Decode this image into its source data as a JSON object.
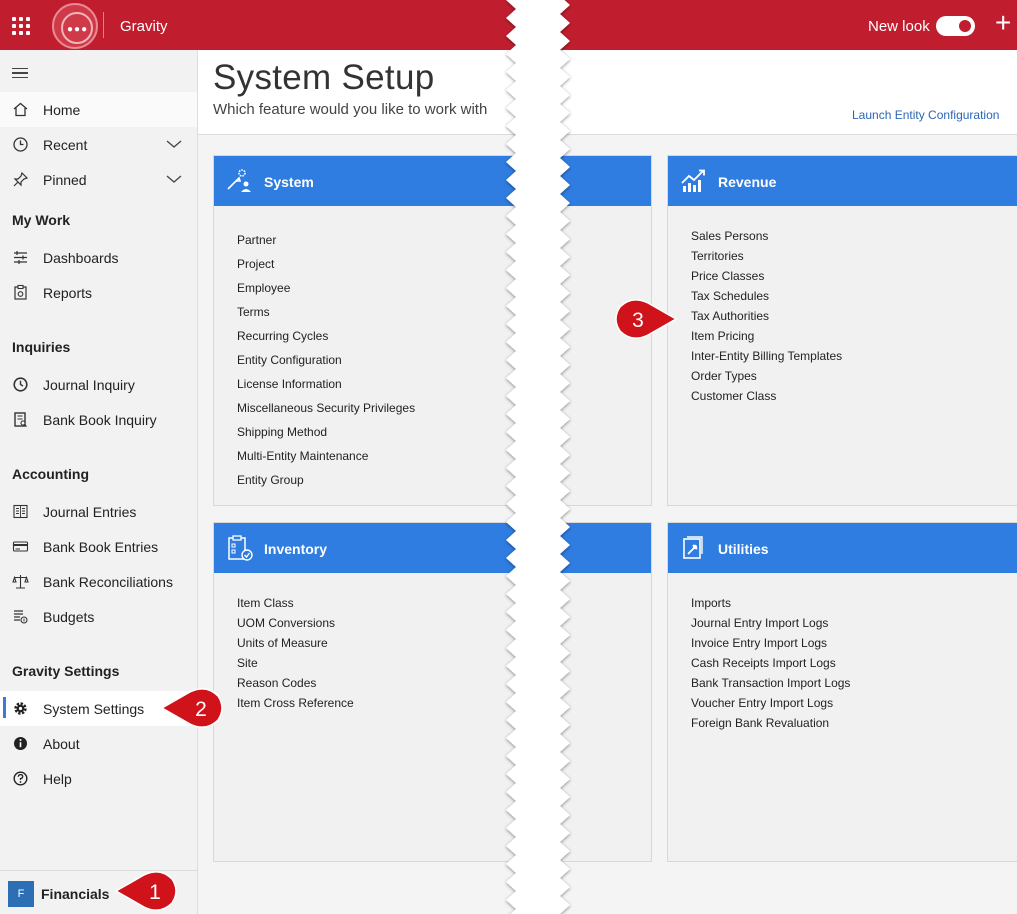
{
  "topbar": {
    "app_name": "Gravity",
    "new_look_label": "New look",
    "new_look_on": true,
    "accent_color": "#c01e2e"
  },
  "sidebar": {
    "top_items": [
      {
        "label": "Home",
        "icon": "home-icon"
      },
      {
        "label": "Recent",
        "icon": "clock-icon"
      },
      {
        "label": "Pinned",
        "icon": "pin-icon"
      }
    ],
    "sections": [
      {
        "title": "My Work",
        "items": [
          {
            "label": "Dashboards",
            "icon": "dashboard-icon"
          },
          {
            "label": "Reports",
            "icon": "report-icon"
          }
        ]
      },
      {
        "title": "Inquiries",
        "items": [
          {
            "label": "Journal Inquiry",
            "icon": "history-icon"
          },
          {
            "label": "Bank Book Inquiry",
            "icon": "book-search-icon"
          }
        ]
      },
      {
        "title": "Accounting",
        "items": [
          {
            "label": "Journal Entries",
            "icon": "ledger-icon"
          },
          {
            "label": "Bank Book Entries",
            "icon": "bank-card-icon"
          },
          {
            "label": "Bank Reconciliations",
            "icon": "scales-icon"
          },
          {
            "label": "Budgets",
            "icon": "budget-icon"
          }
        ]
      },
      {
        "title": "Gravity Settings",
        "items": [
          {
            "label": "System Settings",
            "icon": "gear-icon",
            "active": true
          },
          {
            "label": "About",
            "icon": "info-icon"
          },
          {
            "label": "Help",
            "icon": "help-icon"
          }
        ]
      }
    ],
    "footer": {
      "badge": "F",
      "label": "Financials"
    }
  },
  "main": {
    "title": "System Setup",
    "subtitle": "Which feature would you like to work with",
    "launch_link": "Launch Entity Configuration",
    "cards": {
      "system": {
        "title": "System",
        "links": [
          "Partner",
          "Project",
          "Employee",
          "Terms",
          "Recurring Cycles",
          "Entity Configuration",
          "License Information",
          "Miscellaneous Security Privileges",
          "Shipping Method",
          "Multi-Entity Maintenance",
          "Entity Group"
        ]
      },
      "revenue": {
        "title": "Revenue",
        "links": [
          "Sales Persons",
          "Territories",
          "Price Classes",
          "Tax Schedules",
          "Tax Authorities",
          "Item Pricing",
          "Inter-Entity Billing Templates",
          "Order Types",
          "Customer Class"
        ]
      },
      "inventory": {
        "title": "Inventory",
        "links": [
          "Item Class",
          "UOM Conversions",
          "Units of Measure",
          "Site",
          "Reason Codes",
          "Item Cross Reference"
        ]
      },
      "utilities": {
        "title": "Utilities",
        "links": [
          "Imports",
          "Journal Entry Import Logs",
          "Invoice Entry Import Logs",
          "Cash Receipts Import Logs",
          "Bank Transaction Import Logs",
          "Voucher Entry Import Logs",
          "Foreign Bank Revaluation"
        ]
      }
    }
  },
  "callouts": [
    {
      "number": "1",
      "target": "Financials"
    },
    {
      "number": "2",
      "target": "System Settings"
    },
    {
      "number": "3",
      "target": "Tax Authorities"
    }
  ]
}
